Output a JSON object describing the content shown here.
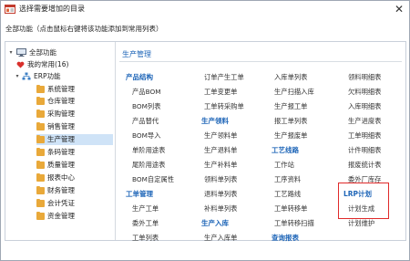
{
  "window": {
    "title": "选择需要增加的目录"
  },
  "hint": "全部功能（点击鼠标右键将该功能添加到常用列表）",
  "tree": {
    "root": "全部功能",
    "favorites": "我的常用(16)",
    "erp": "ERP功能",
    "items": [
      "系统管理",
      "仓库管理",
      "采购管理",
      "销售管理",
      "生产管理",
      "条码管理",
      "质量管理",
      "报表中心",
      "财务管理",
      "会计凭证",
      "资金管理"
    ],
    "selected": "生产管理"
  },
  "content": {
    "title": "生产管理",
    "col1": [
      "产品结构",
      "产品BOM",
      "BOM列表",
      "产品替代",
      "BOM导入",
      "单阶用途表",
      "尾阶用途表",
      "BOM自定属性",
      "工单管理",
      "生产工单",
      "委外工单",
      "工单列表"
    ],
    "col2": [
      "订单产生工单",
      "工单变更单",
      "工单转采购单",
      "生产领料",
      "生产领料单",
      "生产退料单",
      "生产补料单",
      "领料单列表",
      "退料单列表",
      "补料单列表",
      "生产入库",
      "生产入库单"
    ],
    "col3": [
      "入库单列表",
      "生产扫描入库",
      "生产报工单",
      "报工单列表",
      "生产报废单",
      "工艺线路",
      "工作站",
      "工序资料",
      "工艺路线",
      "工单转移单",
      "工单转移扫描",
      "查询报表"
    ],
    "col4": [
      "领料明细表",
      "欠料明细表",
      "入库明细表",
      "生产进度表",
      "工单明细表",
      "计件明细表",
      "报废统计表",
      "委外厂库存",
      "LRP计划",
      "计划生成",
      "计划维护"
    ]
  },
  "colors": {
    "accent": "#1f66b8",
    "selected_bg": "#cfe3f7",
    "highlight": "#e02a2a",
    "folder": "#e9a93a"
  }
}
